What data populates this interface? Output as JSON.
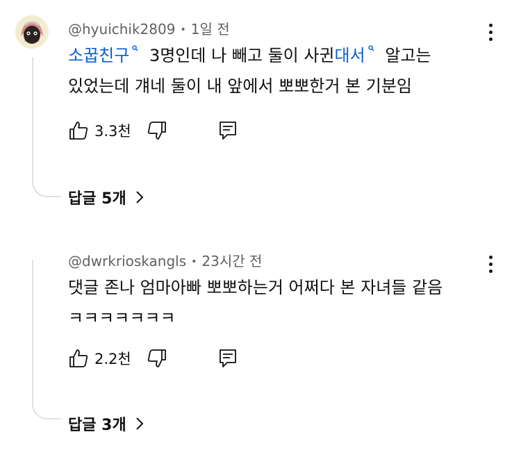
{
  "comments": [
    {
      "username": "@hyuichik2809",
      "time": "1일 전",
      "body_lines": [
        {
          "segments": [
            {
              "text": "소꿉친구",
              "link": true
            },
            {
              "text": " 3명인데 나 빼고 둘이 사귄",
              "link": false
            },
            {
              "text": "대서",
              "link": true
            },
            {
              "text": " 알고는",
              "link": false
            }
          ]
        },
        {
          "segments": [
            {
              "text": "있었는데 걔네 둘이 내 앞에서 뽀뽀한거 본 기분임",
              "link": false
            }
          ]
        }
      ],
      "likes": "3.3천",
      "replies_label": "답글 5개"
    },
    {
      "username": "@dwrkrioskangls",
      "time": "23시간 전",
      "body_lines": [
        {
          "segments": [
            {
              "text": "댓글 존나 엄마아빠 뽀뽀하는거 어쩌다 본 자녀들 같음",
              "link": false
            }
          ]
        },
        {
          "segments": [
            {
              "text": "ㅋㅋㅋㅋㅋㅋㅋ",
              "link": false
            }
          ]
        }
      ],
      "likes": "2.2천",
      "replies_label": "답글 3개"
    }
  ],
  "icons": {
    "like": "thumb-up-icon",
    "dislike": "thumb-down-icon",
    "reply": "reply-comment-icon",
    "menu": "more-vertical-icon",
    "search_link": "search-link-icon",
    "chevron": "chevron-right-icon"
  },
  "colors": {
    "link": "#065fd4",
    "meta": "#606060",
    "text": "#0f0f0f",
    "thread_line": "#e1e1e1"
  }
}
